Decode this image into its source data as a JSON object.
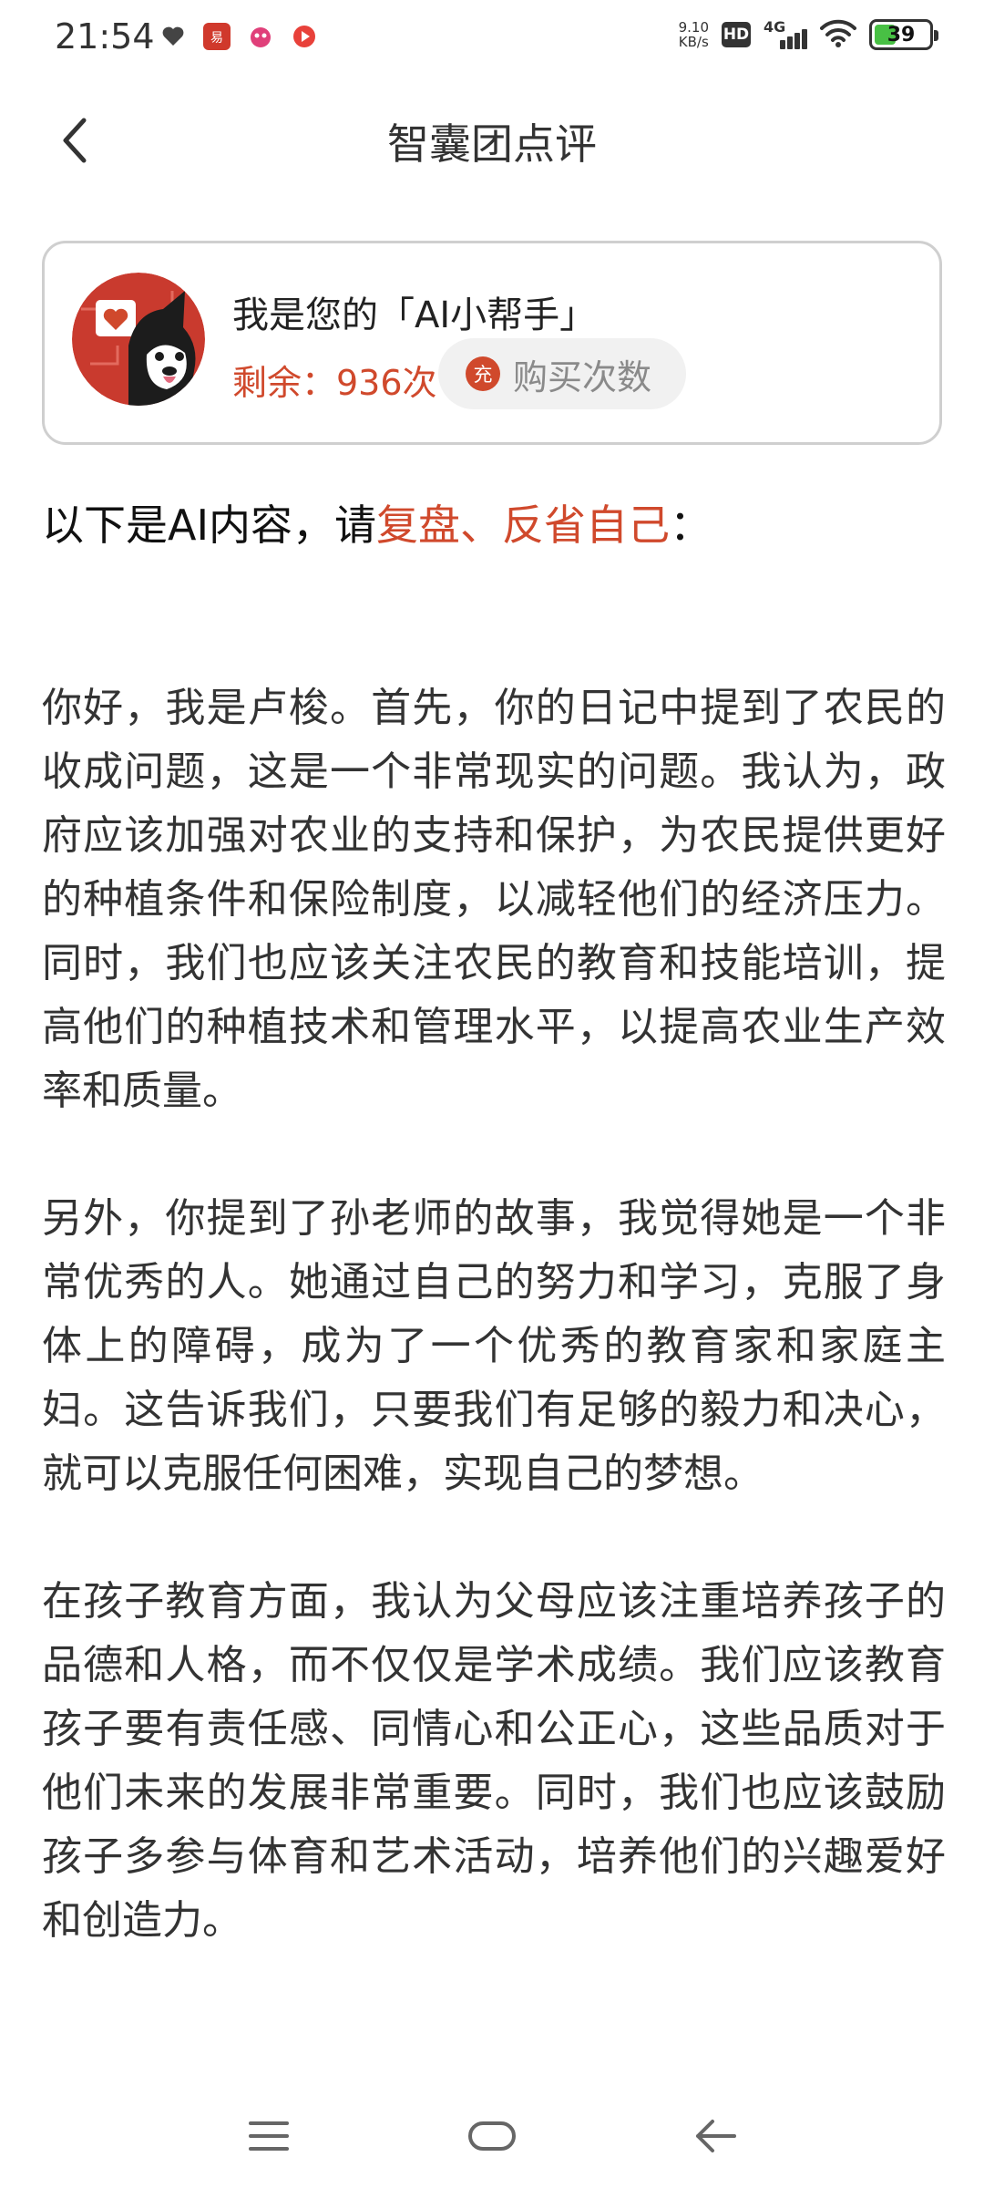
{
  "status_bar": {
    "time": "21:54",
    "net_speed_value": "9.10",
    "net_speed_unit": "KB/s",
    "hd_label": "HD",
    "network_label": "4G",
    "battery_level": "39",
    "notifications": [
      "heart-icon",
      "app-icon-red",
      "app-icon-pink",
      "app-icon-live"
    ]
  },
  "header": {
    "title": "智囊团点评",
    "back_icon": "chevron-left-icon"
  },
  "assistant_card": {
    "title": "我是您的「AI小帮手」",
    "remaining": "剩余：936次",
    "buy_badge": "充",
    "buy_label": "购买次数"
  },
  "intro": {
    "prefix": "以下是AI内容，请",
    "highlight": "复盘、反省自己",
    "suffix": "："
  },
  "content": {
    "paragraphs": [
      "你好，我是卢梭。首先，你的日记中提到了农民的收成问题，这是一个非常现实的问题。我认为，政府应该加强对农业的支持和保护，为农民提供更好的种植条件和保险制度，以减轻他们的经济压力。同时，我们也应该关注农民的教育和技能培训，提高他们的种植技术和管理水平，以提高农业生产效率和质量。",
      "另外，你提到了孙老师的故事，我觉得她是一个非常优秀的人。她通过自己的努力和学习，克服了身体上的障碍，成为了一个优秀的教育家和家庭主妇。这告诉我们，只要我们有足够的毅力和决心，就可以克服任何困难，实现自己的梦想。",
      "在孩子教育方面，我认为父母应该注重培养孩子的品德和人格，而不仅仅是学术成绩。我们应该教育孩子要有责任感、同情心和公正心，这些品质对于他们未来的发展非常重要。同时，我们也应该鼓励孩子多参与体育和艺术活动，培养他们的兴趣爱好和创造力。"
    ]
  },
  "colors": {
    "accent": "#d0492c",
    "text": "#333333",
    "card_border": "#cfcfcf",
    "button_bg": "#f1f1f1",
    "battery": "#48c044"
  },
  "nav_bar": {
    "icons": [
      "menu-icon",
      "home-icon",
      "back-icon"
    ]
  }
}
